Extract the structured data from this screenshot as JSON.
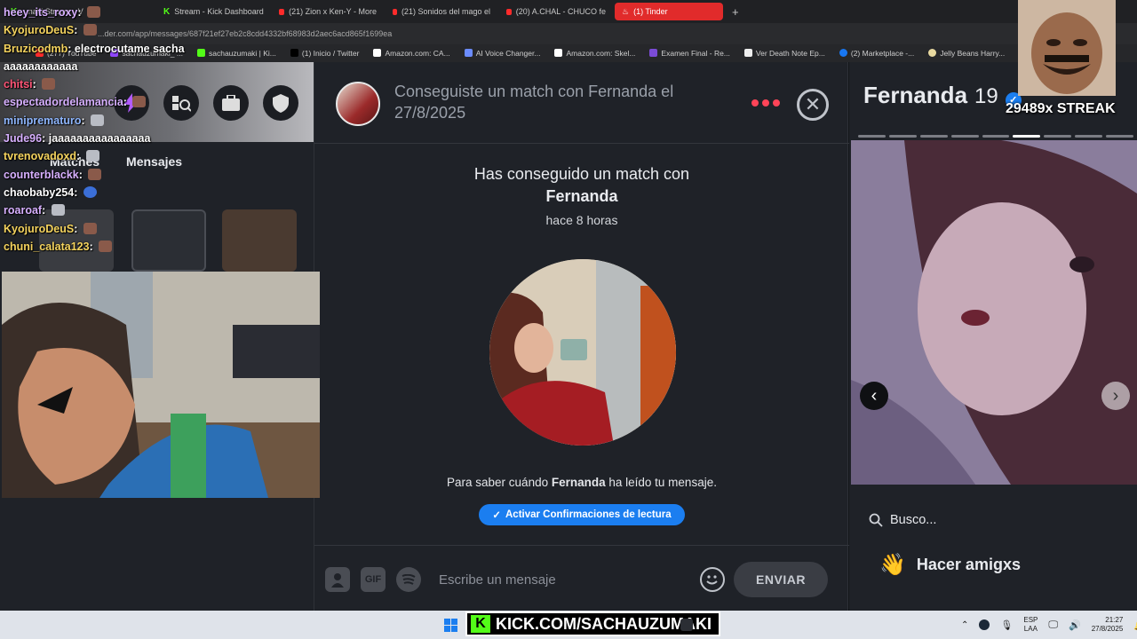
{
  "tabs": [
    {
      "label": "...naki Stream - V",
      "icon": "kick"
    },
    {
      "label": "Stream - Kick Dashboard",
      "icon": "kick"
    },
    {
      "label": "(21) Zion x Ken-Y - More",
      "icon": "youtube"
    },
    {
      "label": "(21) Sonidos del mago el",
      "icon": "youtube"
    },
    {
      "label": "(20) A.CHAL - CHUCO fe",
      "icon": "youtube"
    },
    {
      "label": "(1) Tinder",
      "icon": "tinder",
      "active": true
    }
  ],
  "address": "...der.com/app/messages/687f21ef27eb2c8cdd4332bf68983d2aec6acd865f1699ea",
  "bookmarks": [
    "(277) YouTube",
    "sachauzumaki_ ...",
    "sachauzumaki | Ki...",
    "(1) Inicio / Twitter",
    "Amazon.com: CA...",
    "AI Voice Changer...",
    "Amazon.com: Skel...",
    "Examen Final - Re...",
    "Ver Death Note Ep...",
    "(2) Marketplace -...",
    "Jelly Beans Harry..."
  ],
  "left": {
    "tab_matches": "Matches",
    "tab_messages": "Mensajes"
  },
  "chat": [
    {
      "user": "heey_its_roxy",
      "text": "",
      "color": "#d7b0ff",
      "emote": "face"
    },
    {
      "user": "KyojuroDeuS",
      "text": "",
      "color": "#f4d35e",
      "emote": "face"
    },
    {
      "user": "Bruzicodmb",
      "text": "electrocutame sacha",
      "color": "#f4d35e",
      "emote": ""
    },
    {
      "user": "",
      "text": "aaaaaaaaaaaa",
      "color": "#ffffff",
      "emote": ""
    },
    {
      "user": "chitsi",
      "text": "",
      "color": "#ff5577",
      "emote": "face"
    },
    {
      "user": "espectadordelamancia",
      "text": "",
      "color": "#d7b0ff",
      "emote": "face"
    },
    {
      "user": "miniprematuro",
      "text": "",
      "color": "#8fb7ff",
      "emote": "robot"
    },
    {
      "user": "Jude96",
      "text": "jaaaaaaaaaaaaaaaa",
      "color": "#d7b0ff",
      "emote": ""
    },
    {
      "user": "tvrenovadoxd",
      "text": "",
      "color": "#f4d35e",
      "emote": "robot"
    },
    {
      "user": "counterblackk",
      "text": "",
      "color": "#d7b0ff",
      "emote": "face"
    },
    {
      "user": "chaobaby254",
      "text": "",
      "color": "#ffffff",
      "emote": "heart"
    },
    {
      "user": "roaroaf",
      "text": "",
      "color": "#d7b0ff",
      "emote": "robot"
    },
    {
      "user": "KyojuroDeuS",
      "text": "",
      "color": "#f4d35e",
      "emote": "face"
    },
    {
      "user": "chuni_calata123",
      "text": "",
      "color": "#f4d35e",
      "emote": "face"
    }
  ],
  "conversation": {
    "header_title": "Conseguiste un match con Fernanda el 27/8/2025",
    "match_line": "Has conseguido un match con",
    "match_name": "Fernanda",
    "match_time": "hace 8 horas",
    "read_note_prefix": "Para saber cuándo ",
    "read_note_name": "Fernanda",
    "read_note_suffix": " ha leído tu mensaje.",
    "read_button": "Activar Confirmaciones de lectura",
    "gif_label": "GIF",
    "input_placeholder": "Escribe un mensaje",
    "send_label": "ENVIAR"
  },
  "profile": {
    "name": "Fernanda",
    "age": "19",
    "photo_count": 9,
    "active_photo_index": 5,
    "looking_for": "Busco...",
    "intent": "Hacer amigxs"
  },
  "overlay": {
    "streak": "29489x STREAK",
    "kick_banner": "KICK.COM/SACHAUZUMAKI"
  },
  "tray": {
    "lang_top": "ESP",
    "lang_bottom": "LAA",
    "time": "21:27",
    "date": "27/8/2025"
  },
  "colors": {
    "tinder_red": "#ff4458",
    "accent_blue": "#1b7ef0",
    "kick_green": "#53fc18"
  }
}
